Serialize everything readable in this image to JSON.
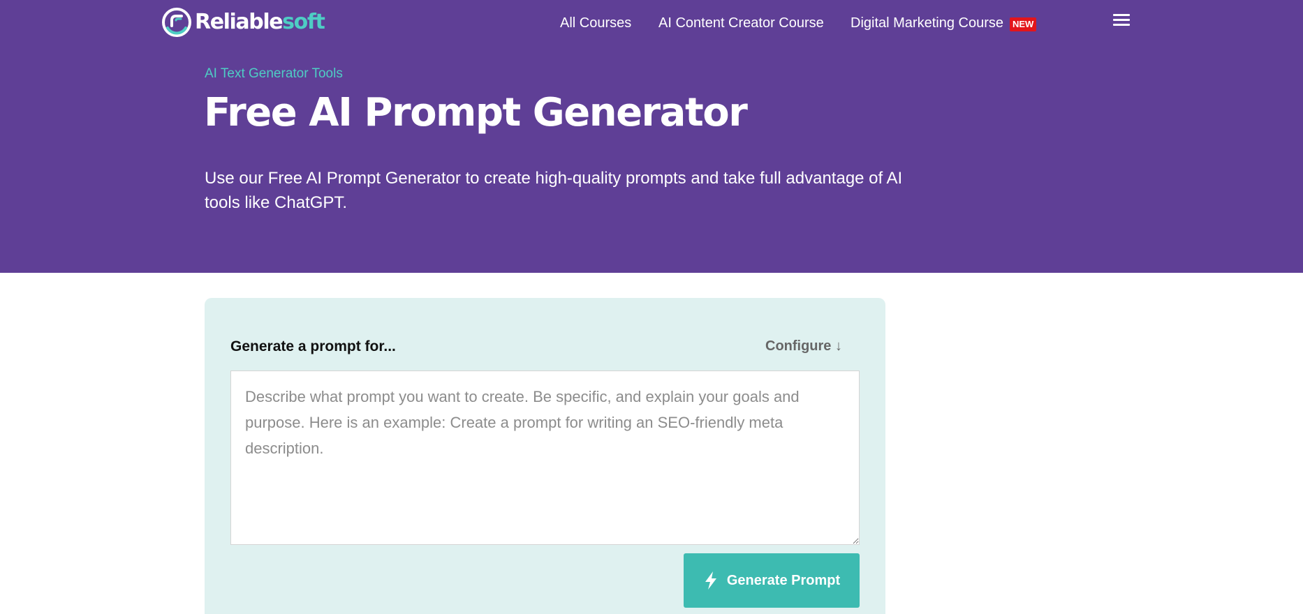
{
  "header": {
    "logo": {
      "text_main": "Reliable",
      "text_accent": "soft"
    },
    "nav": [
      {
        "label": "All Courses"
      },
      {
        "label": "AI Content Creator Course"
      },
      {
        "label": "Digital Marketing Course",
        "badge": "NEW"
      }
    ],
    "menu_icon": "hamburger-menu-icon"
  },
  "hero": {
    "breadcrumb": "AI Text Generator Tools",
    "title": "Free AI Prompt Generator",
    "intro": "Use our Free AI Prompt Generator to create high-quality prompts and take full advantage of AI tools like ChatGPT."
  },
  "tool": {
    "label": "Generate a prompt for...",
    "configure": "Configure ↓",
    "input": {
      "value": "",
      "placeholder": "Describe what prompt you want to create. Be specific, and explain your goals and purpose. Here is an example: Create a prompt for writing an SEO-friendly meta description."
    },
    "button": {
      "label": "Generate Prompt",
      "icon": "lightning-bolt-icon"
    }
  },
  "colors": {
    "header_bg": "#5f3f96",
    "accent_teal": "#4ecdc4",
    "button_bg": "#3dbbb1",
    "card_bg": "#dff1f0",
    "badge_red": "#e3151b"
  }
}
